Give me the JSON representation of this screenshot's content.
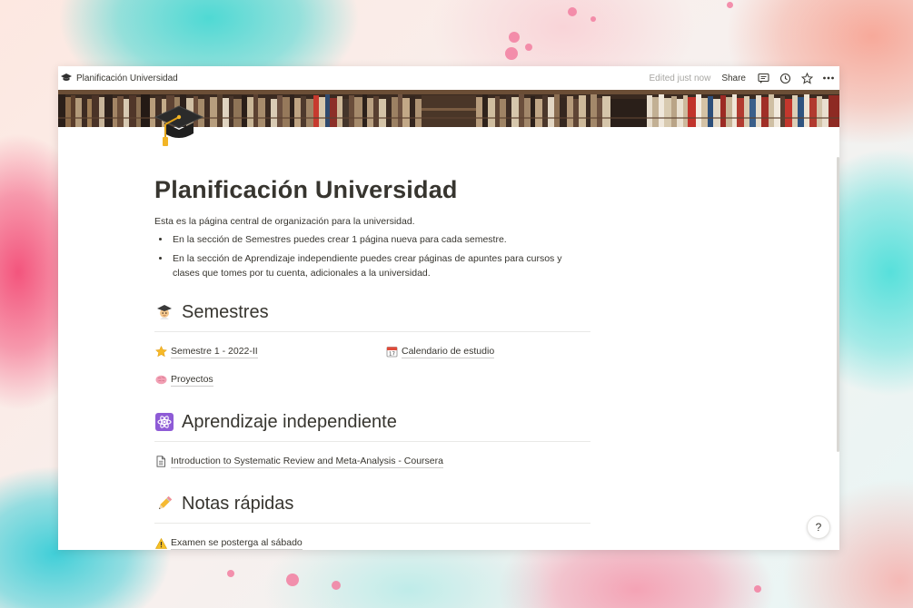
{
  "topbar": {
    "page_title": "Planificación Universidad",
    "edited": "Edited just now",
    "share": "Share",
    "icons": [
      "comment-icon",
      "history-icon",
      "star-icon",
      "more-icon"
    ]
  },
  "page": {
    "icon": "graduation-cap-icon",
    "title": "Planificación Universidad",
    "description": "Esta es la página central de organización para la universidad.",
    "bullets": [
      "En la sección de Semestres puedes crear 1 página nueva para cada semestre.",
      "En la sección de Aprendizaje independiente puedes crear páginas de apuntes para cursos y clases que tomes por tu cuenta, adicionales a la universidad."
    ]
  },
  "sections": {
    "semestres": {
      "icon": "student-icon",
      "heading": "Semestres",
      "links": [
        {
          "icon": "star-emoji-icon",
          "label": "Semestre 1 - 2022-II"
        },
        {
          "icon": "calendar-icon",
          "label": "Calendario de estudio"
        },
        {
          "icon": "brain-icon",
          "label": "Proyectos"
        }
      ]
    },
    "aprendizaje": {
      "icon": "atom-icon",
      "heading": "Aprendizaje independiente",
      "links": [
        {
          "icon": "document-icon",
          "label": "Introduction to Systematic Review and Meta-Analysis - Coursera"
        }
      ]
    },
    "notas": {
      "icon": "pencil-icon",
      "heading": "Notas rápidas",
      "links": [
        {
          "icon": "warning-icon",
          "label": "Examen se posterga al sábado"
        }
      ]
    }
  },
  "help": {
    "label": "?"
  },
  "colors": {
    "text": "#37352f",
    "muted": "#a7a6a2",
    "divider": "#e9e9e7",
    "atom_bg": "#8e5bd6"
  }
}
